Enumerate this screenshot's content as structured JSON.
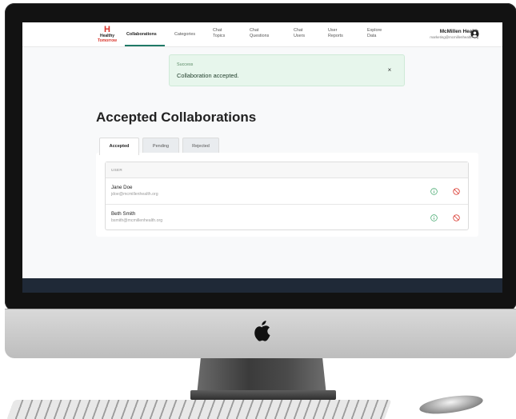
{
  "brand": {
    "mark": "H",
    "line1": "Healthy",
    "line2": "Tomorrow"
  },
  "nav": [
    {
      "label": "Collaborations",
      "active": true
    },
    {
      "label": "Categories"
    },
    {
      "label": "Chat\nTopics"
    },
    {
      "label": "Chat\nQuestions"
    },
    {
      "label": "Chat\nUsers"
    },
    {
      "label": "User\nReports"
    },
    {
      "label": "Explore\nData"
    }
  ],
  "account": {
    "name": "McMillen Health",
    "email": "marketing@mcmillenhealth.org"
  },
  "toast": {
    "title": "Success",
    "message": "Collaboration accepted.",
    "close": "×"
  },
  "page": {
    "title": "Accepted Collaborations"
  },
  "tabs": [
    {
      "label": "Accepted",
      "active": true
    },
    {
      "label": "Pending"
    },
    {
      "label": "Rejected"
    }
  ],
  "table": {
    "header": "USER",
    "rows": [
      {
        "name": "Jane Doe",
        "email": "jdoe@mcmillenhealth.org"
      },
      {
        "name": "Beth Smith",
        "email": "bsmith@mcmillenhealth.org"
      }
    ]
  },
  "icons": {
    "user": "user-circle-icon",
    "info": "info-circle-icon",
    "block": "ban-icon",
    "apple": "apple-logo-icon"
  },
  "colors": {
    "accent": "#1f7a66",
    "success_bg": "#e7f6ec",
    "brand_red": "#d9342b",
    "info_green": "#3fa66a",
    "block_red": "#d9342b"
  }
}
